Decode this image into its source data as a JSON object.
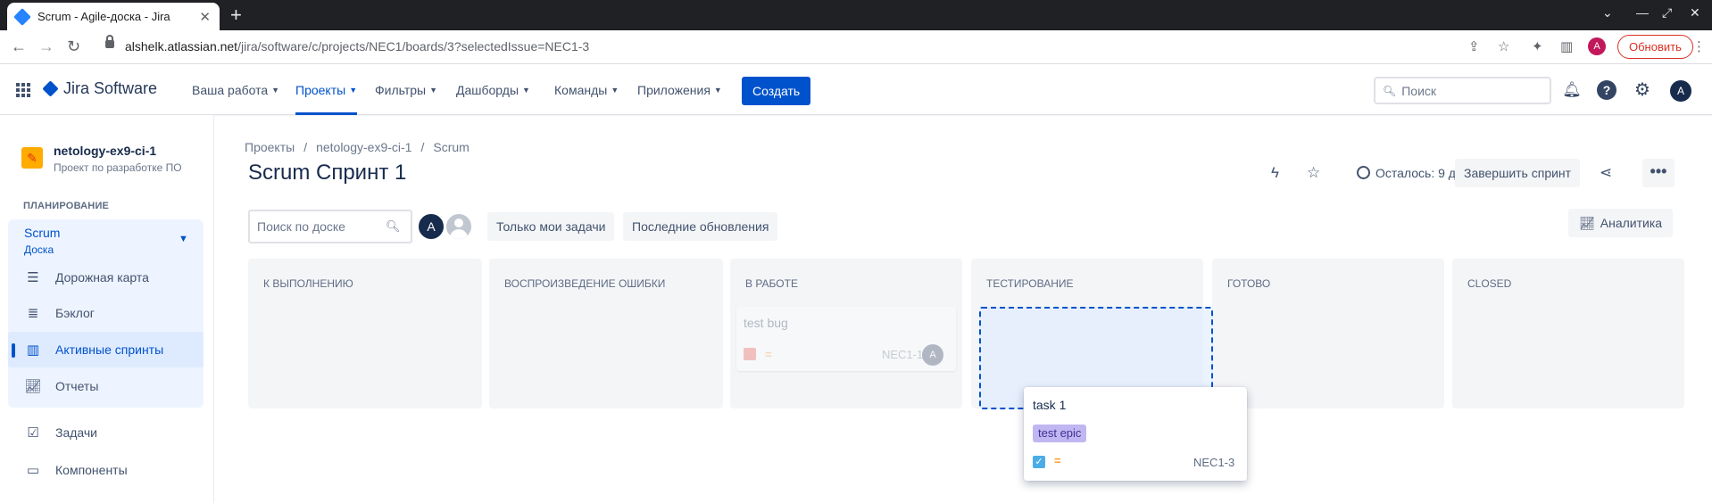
{
  "browser": {
    "tab_title": "Scrum - Agile-доска - Jira",
    "url_host": "alshelk.atlassian.net",
    "url_path": "/jira/software/c/projects/NEC1/boards/3?selectedIssue=NEC1-3",
    "profile_initial": "A",
    "update_label": "Обновить"
  },
  "topnav": {
    "logo_text": "Jira Software",
    "menu": [
      "Ваша работа",
      "Проекты",
      "Фильтры",
      "Дашборды",
      "Команды",
      "Приложения"
    ],
    "create_label": "Создать",
    "search_placeholder": "Поиск",
    "user_initial": "A"
  },
  "sidebar": {
    "project_name": "netology-ex9-ci-1",
    "project_type": "Проект по разработке ПО",
    "section_heading": "ПЛАНИРОВАНИЕ",
    "board_title": "Scrum",
    "board_subtitle": "Доска",
    "items": [
      "Дорожная карта",
      "Бэклог",
      "Активные спринты",
      "Отчеты",
      "Задачи",
      "Компоненты"
    ]
  },
  "header": {
    "breadcrumb": [
      "Проекты",
      "/",
      "netology-ex9-ci-1",
      "/",
      "Scrum"
    ],
    "title": "Scrum Спринт 1",
    "remaining": "Осталось: 9 дн.",
    "finish_sprint_label": "Завершить спринт",
    "more_label": "•••"
  },
  "toolbar": {
    "search_placeholder": "Поиск по доске",
    "avatar_initial": "A",
    "filters": [
      "Только мои задачи",
      "Последние обновления"
    ],
    "analytics_label": "Аналитика"
  },
  "board": {
    "columns": [
      "К ВЫПОЛНЕНИЮ",
      "ВОСПРОИЗВЕДЕНИЕ ОШИБКИ",
      "В РАБОТЕ",
      "ТЕСТИРОВАНИЕ",
      "ГОТОВО",
      "CLOSED"
    ],
    "ghost_card": {
      "title": "test bug",
      "key": "NEC1-1",
      "assignee_initial": "A"
    },
    "dragging_card": {
      "title": "task 1",
      "epic": "test epic",
      "key": "NEC1-3"
    }
  },
  "colors": {
    "primary": "#0052cc",
    "column_bg": "#f4f5f7",
    "epic_bg": "#c0b6f2",
    "bug": "#e5493a",
    "task": "#4bade8",
    "priority_medium": "#ff991f"
  }
}
